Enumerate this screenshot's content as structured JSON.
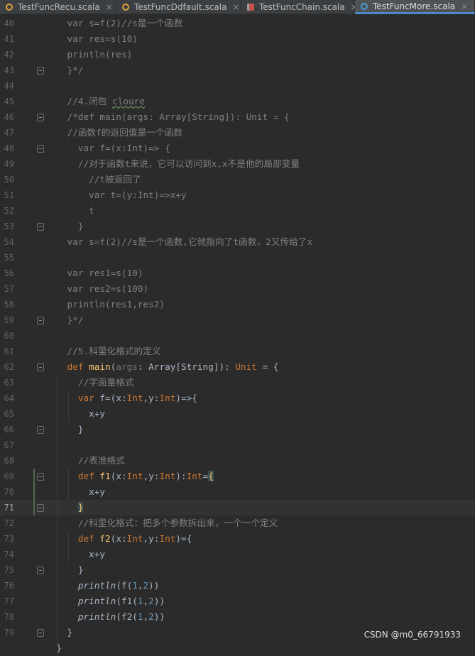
{
  "tabs": [
    {
      "label": "TestFuncRecu.scala",
      "close": "×",
      "icon": "scala-object-icon",
      "active": false
    },
    {
      "label": "TestFuncDdfault.scala",
      "close": "×",
      "icon": "scala-object-icon",
      "active": false
    },
    {
      "label": "TestFuncChain.scala",
      "close": "×",
      "icon": "scala-class-icon",
      "active": false
    },
    {
      "label": "TestFuncMore.scala",
      "close": "×",
      "icon": "scala-object-icon",
      "active": true
    }
  ],
  "current_line": "71",
  "lines": [
    {
      "n": "40",
      "t": [
        [
          "    var s=f(2)//s是一个函数",
          "cm"
        ]
      ]
    },
    {
      "n": "41",
      "t": [
        [
          "    var res=s(10)",
          "cm"
        ]
      ]
    },
    {
      "n": "42",
      "t": [
        [
          "    println(res)",
          "cm"
        ]
      ]
    },
    {
      "n": "43",
      "t": [
        [
          "    }*/",
          "cm"
        ]
      ]
    },
    {
      "n": "44",
      "t": []
    },
    {
      "n": "45",
      "t": [
        [
          "    //4.闭包 ",
          "cm"
        ],
        [
          "cloure",
          "cmu"
        ]
      ]
    },
    {
      "n": "46",
      "t": [
        [
          "    /*def main(args: Array[String]): Unit = {",
          "cm"
        ]
      ]
    },
    {
      "n": "47",
      "t": [
        [
          "    //函数f的返回值是一个函数",
          "cm"
        ]
      ]
    },
    {
      "n": "48",
      "t": [
        [
          "      var f=(x:Int)=> {",
          "cm"
        ]
      ]
    },
    {
      "n": "49",
      "t": [
        [
          "      //对于函数t来说，它可以访问到x,x不是他的局部变量",
          "cm"
        ]
      ]
    },
    {
      "n": "50",
      "t": [
        [
          "        //t被返回了",
          "cm"
        ]
      ]
    },
    {
      "n": "51",
      "t": [
        [
          "        var t=(y:Int)=>x+y",
          "cm"
        ]
      ]
    },
    {
      "n": "52",
      "t": [
        [
          "        t",
          "cm"
        ]
      ]
    },
    {
      "n": "53",
      "t": [
        [
          "      }",
          "cm"
        ]
      ]
    },
    {
      "n": "54",
      "t": [
        [
          "    var s=f(2)//s是一个函数,它就指向了t函数，2又传给了x",
          "cm"
        ]
      ]
    },
    {
      "n": "55",
      "t": []
    },
    {
      "n": "56",
      "t": [
        [
          "    var res1=s(10)",
          "cm"
        ]
      ]
    },
    {
      "n": "57",
      "t": [
        [
          "    var res2=s(100)",
          "cm"
        ]
      ]
    },
    {
      "n": "58",
      "t": [
        [
          "    println(res1,res2)",
          "cm"
        ]
      ]
    },
    {
      "n": "59",
      "t": [
        [
          "    }*/",
          "cm"
        ]
      ]
    },
    {
      "n": "60",
      "t": []
    },
    {
      "n": "61",
      "t": [
        [
          "    //5.科里化格式的定义",
          "cm"
        ]
      ]
    },
    {
      "n": "62",
      "t": [
        [
          "    ",
          ""
        ],
        [
          "def",
          "kw"
        ],
        [
          " ",
          ""
        ],
        [
          "main",
          "fn"
        ],
        [
          "(",
          ""
        ],
        [
          "args",
          "pr"
        ],
        [
          ": Array[String]): ",
          ""
        ],
        [
          "Unit",
          "kw"
        ],
        [
          " = {",
          ""
        ]
      ]
    },
    {
      "n": "63",
      "t": [
        [
          "      //字面量格式",
          "cm"
        ]
      ]
    },
    {
      "n": "64",
      "t": [
        [
          "      ",
          ""
        ],
        [
          "var",
          "kw"
        ],
        [
          " f=(x:",
          ""
        ],
        [
          "Int",
          "kw"
        ],
        [
          ",y:",
          ""
        ],
        [
          "Int",
          "kw"
        ],
        [
          ")=>{",
          ""
        ]
      ]
    },
    {
      "n": "65",
      "t": [
        [
          "        x+y",
          ""
        ]
      ]
    },
    {
      "n": "66",
      "t": [
        [
          "      }",
          ""
        ]
      ]
    },
    {
      "n": "67",
      "t": []
    },
    {
      "n": "68",
      "t": [
        [
          "      //表准格式",
          "cm"
        ]
      ]
    },
    {
      "n": "69",
      "t": [
        [
          "      ",
          ""
        ],
        [
          "def",
          "kw"
        ],
        [
          " ",
          ""
        ],
        [
          "f1",
          "fn"
        ],
        [
          "(x:",
          ""
        ],
        [
          "Int",
          "kw"
        ],
        [
          ",y:",
          ""
        ],
        [
          "Int",
          "kw"
        ],
        [
          "):",
          ""
        ],
        [
          "Int",
          "kw"
        ],
        [
          "=",
          ""
        ],
        [
          "{",
          "brc"
        ]
      ]
    },
    {
      "n": "70",
      "t": [
        [
          "        x+y",
          ""
        ]
      ]
    },
    {
      "n": "71",
      "t": [
        [
          "      ",
          ""
        ],
        [
          "}",
          "brc"
        ]
      ]
    },
    {
      "n": "72",
      "t": [
        [
          "      //科里化格式：把多个参数拆出来，一个一个定义",
          "cm"
        ]
      ]
    },
    {
      "n": "73",
      "t": [
        [
          "      ",
          ""
        ],
        [
          "def",
          "kw"
        ],
        [
          " ",
          ""
        ],
        [
          "f2",
          "fn"
        ],
        [
          "(x:",
          ""
        ],
        [
          "Int",
          "kw"
        ],
        [
          ",y:",
          ""
        ],
        [
          "Int",
          "kw"
        ],
        [
          ")={",
          ""
        ]
      ]
    },
    {
      "n": "74",
      "t": [
        [
          "        x+y",
          ""
        ]
      ]
    },
    {
      "n": "75",
      "t": [
        [
          "      }",
          ""
        ]
      ]
    },
    {
      "n": "76",
      "t": [
        [
          "      ",
          ""
        ],
        [
          "println",
          "it"
        ],
        [
          "(f(",
          ""
        ],
        [
          "1",
          "nm"
        ],
        [
          ",",
          ""
        ],
        [
          "2",
          "nm"
        ],
        [
          "))",
          ""
        ]
      ]
    },
    {
      "n": "77",
      "t": [
        [
          "      ",
          ""
        ],
        [
          "println",
          "it"
        ],
        [
          "(f1(",
          ""
        ],
        [
          "1",
          "nm"
        ],
        [
          ",",
          ""
        ],
        [
          "2",
          "nm"
        ],
        [
          "))",
          ""
        ]
      ]
    },
    {
      "n": "78",
      "t": [
        [
          "      ",
          ""
        ],
        [
          "println",
          "it"
        ],
        [
          "(f2(",
          ""
        ],
        [
          "1",
          "nm"
        ],
        [
          ",",
          ""
        ],
        [
          "2",
          "nm"
        ],
        [
          "))",
          ""
        ]
      ]
    },
    {
      "n": "79",
      "t": [
        [
          "    }",
          ""
        ]
      ]
    },
    {
      "n": "",
      "t": [
        [
          "  }",
          ""
        ]
      ]
    }
  ],
  "fold_lines": [
    "43",
    "46",
    "48",
    "53",
    "59",
    "62",
    "66",
    "69",
    "71",
    "75",
    "79"
  ],
  "watermark": "CSDN @m0_66791933",
  "colors": {
    "bg": "#2b2b2b",
    "text": "#a9b7c6",
    "comment": "#808080",
    "keyword": "#cc7832",
    "function": "#ffc66d",
    "param": "#72737a",
    "number": "#6897bb",
    "brace_match": "#3b514d"
  }
}
